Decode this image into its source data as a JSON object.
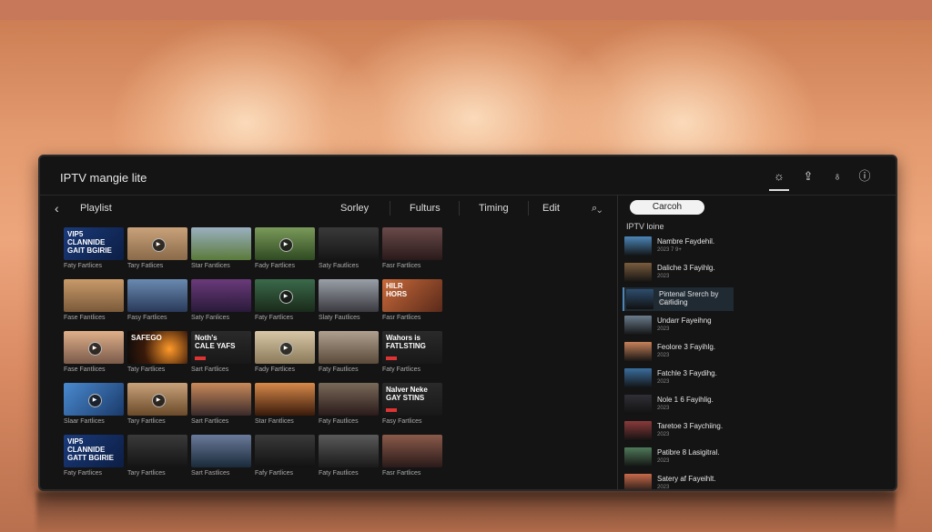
{
  "app": {
    "title": "IPTV mangie lite"
  },
  "titlebar_icons": [
    {
      "name": "settings-sun-icon",
      "glyph": "☼",
      "active": true
    },
    {
      "name": "share-icon",
      "glyph": "⇪",
      "active": false
    },
    {
      "name": "bulb-icon",
      "glyph": "♁",
      "active": false
    },
    {
      "name": "info-icon",
      "glyph": "ⓘ",
      "active": false
    }
  ],
  "nav": {
    "back_glyph": "‹",
    "title": "Playlist",
    "tabs": [
      "Sorley",
      "Fulturs",
      "Timing",
      "Edit"
    ],
    "mic_glyph": "⌕⌄"
  },
  "search": {
    "label": "Carcoh"
  },
  "sidebar": {
    "title": "IPTV loine",
    "items": [
      {
        "title": "Nambre Faydehil.",
        "sub": "2023 7 9+",
        "color": "#4c86b8",
        "selected": false
      },
      {
        "title": "Daliche 3 Fayihlg.",
        "sub": "2023",
        "color": "#7a5c3e",
        "selected": false
      },
      {
        "title": "Pintenal Srerch by Carliding",
        "sub": "2023",
        "color": "#2e4d6e",
        "selected": true
      },
      {
        "title": "Undarr Fayeihng",
        "sub": "2023",
        "color": "#6a7c8c",
        "selected": false
      },
      {
        "title": "Feolore 3 Fayihlg.",
        "sub": "2023",
        "color": "#c7825a",
        "selected": false
      },
      {
        "title": "Fatchle 3 Faydihg.",
        "sub": "2023",
        "color": "#3b6e9e",
        "selected": false
      },
      {
        "title": "Nole 1 6 Fayihlig.",
        "sub": "2023",
        "color": "#2f2f36",
        "selected": false
      },
      {
        "title": "Taretoe 3 Faychiing.",
        "sub": "2023",
        "color": "#8a3a3a",
        "selected": false
      },
      {
        "title": "Patibre 8 Lasigitral.",
        "sub": "2023",
        "color": "#4f7a5a",
        "selected": false
      },
      {
        "title": "Satery af Fayeihlt.",
        "sub": "2023",
        "color": "#c96a4a",
        "selected": false
      }
    ]
  },
  "grid": [
    [
      {
        "cap": "Faty Fartlices",
        "bg": "linear-gradient(135deg,#1a3a7a,#0c1e44)",
        "text": "VIP5 CLANNIDE\nGAIT BGIRIE",
        "play": false,
        "bad": false
      },
      {
        "cap": "Tary Fatlices",
        "bg": "linear-gradient(180deg,#c9a27a,#8a6a4a)",
        "text": "",
        "play": true,
        "bad": false
      },
      {
        "cap": "Star Fantlices",
        "bg": "linear-gradient(180deg,#9ab0c0,#5a7a3a)",
        "text": "",
        "play": false,
        "bad": false
      },
      {
        "cap": "Fady Fartlices",
        "bg": "linear-gradient(180deg,#7a9a5a,#2f4a22)",
        "text": "",
        "play": true,
        "bad": false
      },
      {
        "cap": "Saty Fautlices",
        "bg": "linear-gradient(180deg,#3a3a3a,#151515)",
        "text": "",
        "play": false,
        "bad": false
      },
      {
        "cap": "Fasr Fartlices",
        "bg": "linear-gradient(180deg,#6a4a4a,#2a1a1a)",
        "text": "",
        "play": false,
        "bad": false
      }
    ],
    [
      {
        "cap": "Fase Fantlices",
        "bg": "linear-gradient(180deg,#c99a6a,#7a5a3a)",
        "text": "",
        "play": false,
        "bad": false
      },
      {
        "cap": "Fasy Fartlices",
        "bg": "linear-gradient(180deg,#6a8ab0,#2a3a5a)",
        "text": "",
        "play": false,
        "bad": false
      },
      {
        "cap": "Saty Fanlices",
        "bg": "linear-gradient(180deg,#6a3a7a,#2a1a3a)",
        "text": "",
        "play": false,
        "bad": false
      },
      {
        "cap": "Faty Fartlices",
        "bg": "linear-gradient(180deg,#3a6a4a,#1a2a1a)",
        "text": "",
        "play": true,
        "bad": false
      },
      {
        "cap": "Slaty Fautlices",
        "bg": "linear-gradient(180deg,#9aa0a8,#3a3a40)",
        "text": "",
        "play": false,
        "bad": false
      },
      {
        "cap": "Fasr Fartlices",
        "bg": "linear-gradient(135deg,#c96a3a,#5a2a1a)",
        "text": "HILR\nHORS",
        "play": false,
        "bad": false
      }
    ],
    [
      {
        "cap": "Fase Fantlices",
        "bg": "linear-gradient(180deg,#e0b08a,#7a5a4a)",
        "text": "",
        "play": true,
        "bad": false
      },
      {
        "cap": "Taty Fartlices",
        "bg": "radial-gradient(circle at 70% 55%,#ff9a2a,#3a1a0a 55%,#0a0a0a)",
        "text": "SAFEGO",
        "play": false,
        "bad": false
      },
      {
        "cap": "Sart Fartlices",
        "bg": "linear-gradient(180deg,#2a2a2a,#181818)",
        "text": "Noth's\nCALE YAFS",
        "play": false,
        "bad": true
      },
      {
        "cap": "Fady Fartlices",
        "bg": "linear-gradient(180deg,#d8c8a8,#8a7a5a)",
        "text": "",
        "play": true,
        "bad": false
      },
      {
        "cap": "Faty Fautlices",
        "bg": "linear-gradient(180deg,#b0a090,#5a4a3a)",
        "text": "",
        "play": false,
        "bad": false
      },
      {
        "cap": "Faty Fartlices",
        "bg": "linear-gradient(180deg,#2a2a2a,#181818)",
        "text": "Wahors is\nFATLSTING",
        "play": false,
        "bad": true
      }
    ],
    [
      {
        "cap": "Slaar Fartlices",
        "bg": "linear-gradient(135deg,#4a8ad0,#1a3a6a)",
        "text": "",
        "play": true,
        "bad": false
      },
      {
        "cap": "Tary Fartlices",
        "bg": "linear-gradient(180deg,#c9a27a,#6a4a2a)",
        "text": "",
        "play": true,
        "bad": false
      },
      {
        "cap": "Sart Fartlices",
        "bg": "linear-gradient(180deg,#c98a5a,#3a2a2a)",
        "text": "",
        "play": false,
        "bad": false
      },
      {
        "cap": "Star Fantlices",
        "bg": "linear-gradient(180deg,#d88a4a,#3a1a0a)",
        "text": "",
        "play": false,
        "bad": false
      },
      {
        "cap": "Faty Fautlices",
        "bg": "linear-gradient(180deg,#7a6a5a,#2a1a1a)",
        "text": "",
        "play": false,
        "bad": false
      },
      {
        "cap": "Fasy Fartlices",
        "bg": "linear-gradient(180deg,#2a2a2a,#181818)",
        "text": "Nalver Neke\nGAY STINS",
        "play": false,
        "bad": true
      }
    ],
    [
      {
        "cap": "Faty Fartlices",
        "bg": "linear-gradient(135deg,#1a3a7a,#0c1e44)",
        "text": "VIP5 CLANNIDE\nGATT BGIRIE",
        "play": false,
        "bad": false
      },
      {
        "cap": "Tary Fartlices",
        "bg": "linear-gradient(180deg,#3a3a3a,#141414)",
        "text": "",
        "play": false,
        "bad": false
      },
      {
        "cap": "Sart Fastlices",
        "bg": "linear-gradient(180deg,#6a7a9a,#1a2a3a)",
        "text": "",
        "play": false,
        "bad": false
      },
      {
        "cap": "Fafy Fartlices",
        "bg": "linear-gradient(180deg,#3a3a3a,#121212)",
        "text": "",
        "play": false,
        "bad": false
      },
      {
        "cap": "Faty Fautlices",
        "bg": "linear-gradient(180deg,#5a5a5a,#1a1a1a)",
        "text": "",
        "play": false,
        "bad": false
      },
      {
        "cap": "Fasr Fartlices",
        "bg": "linear-gradient(180deg,#8a5a4a,#2a1a1a)",
        "text": "",
        "play": false,
        "bad": false
      }
    ]
  ]
}
